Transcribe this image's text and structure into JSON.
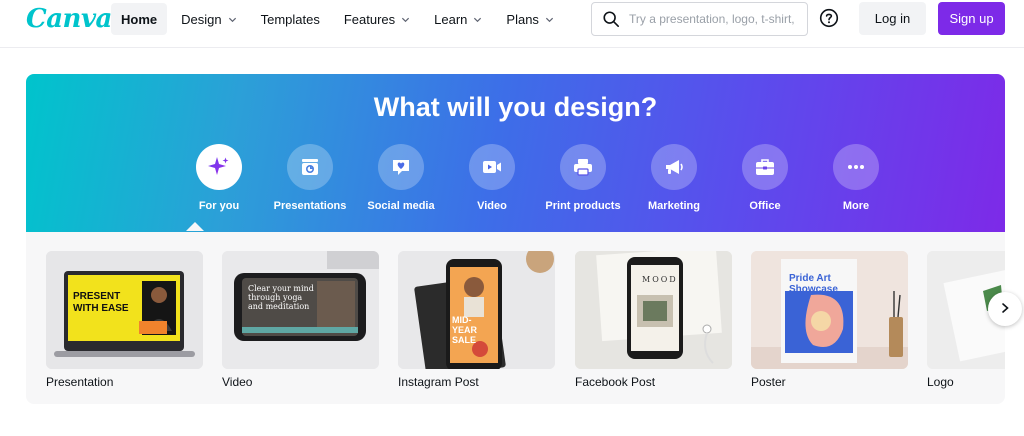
{
  "header": {
    "logo": "Canva",
    "nav": [
      {
        "label": "Home",
        "dropdown": false,
        "active": true
      },
      {
        "label": "Design",
        "dropdown": true
      },
      {
        "label": "Templates",
        "dropdown": false
      },
      {
        "label": "Features",
        "dropdown": true
      },
      {
        "label": "Learn",
        "dropdown": true
      },
      {
        "label": "Plans",
        "dropdown": true
      }
    ],
    "search_placeholder": "Try a presentation, logo, t-shirt,",
    "help_icon": "question-circle-icon",
    "login_label": "Log in",
    "signup_label": "Sign up",
    "brand_color": "#7d2ae8",
    "logo_color": "#00c4cc"
  },
  "hero": {
    "title": "What will you design?",
    "gradient": [
      "#00c4cc",
      "#3d6ee8",
      "#7d2ae8"
    ],
    "categories": [
      {
        "label": "For you",
        "icon": "sparkle-icon",
        "active": true
      },
      {
        "label": "Presentations",
        "icon": "presentation-icon"
      },
      {
        "label": "Social media",
        "icon": "heart-chat-icon"
      },
      {
        "label": "Video",
        "icon": "video-camera-icon"
      },
      {
        "label": "Print products",
        "icon": "printer-icon"
      },
      {
        "label": "Marketing",
        "icon": "megaphone-icon"
      },
      {
        "label": "Office",
        "icon": "briefcase-icon"
      },
      {
        "label": "More",
        "icon": "more-dots-icon"
      }
    ]
  },
  "designs": {
    "items": [
      {
        "label": "Presentation",
        "thumb_text": "PRESENT WITH EASE"
      },
      {
        "label": "Video",
        "thumb_text": "Clear your mind through yoga and meditation"
      },
      {
        "label": "Instagram Post",
        "thumb_text": "MID-YEAR SALE"
      },
      {
        "label": "Facebook Post",
        "thumb_text": "MOOD"
      },
      {
        "label": "Poster",
        "thumb_text": "Pride Art Showcase"
      },
      {
        "label": "Logo",
        "thumb_text": ""
      }
    ],
    "next_icon": "chevron-right-icon"
  }
}
